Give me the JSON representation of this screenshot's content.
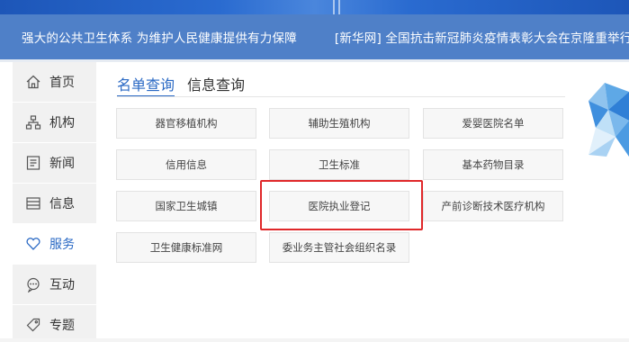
{
  "ticker": {
    "items": [
      "强大的公共卫生体系 为维护人民健康提供有力保障",
      "[新华网] 全国抗击新冠肺炎疫情表彰大会在京隆重举行习近平"
    ]
  },
  "sidebar": {
    "items": [
      {
        "label": "首页",
        "icon": "home-icon"
      },
      {
        "label": "机构",
        "icon": "org-chart-icon"
      },
      {
        "label": "新闻",
        "icon": "news-icon"
      },
      {
        "label": "信息",
        "icon": "tray-icon"
      },
      {
        "label": "服务",
        "icon": "heart-icon",
        "active": true
      },
      {
        "label": "互动",
        "icon": "chat-icon"
      },
      {
        "label": "专题",
        "icon": "tag-icon"
      }
    ]
  },
  "tabs": [
    {
      "label": "名单查询",
      "active": true
    },
    {
      "label": "信息查询",
      "active": false
    }
  ],
  "grid": {
    "items": [
      "器官移植机构",
      "辅助生殖机构",
      "爱婴医院名单",
      "信用信息",
      "卫生标准",
      "基本药物目录",
      "国家卫生城镇",
      "医院执业登记",
      "产前诊断技术医疗机构",
      "卫生健康标准网",
      "委业务主管社会组织名录"
    ]
  },
  "colors": {
    "accent": "#2a69c4",
    "highlight": "#e0282a",
    "ticker_bg": "#4f80c8",
    "sidebar_bg": "#f1f1f1"
  }
}
